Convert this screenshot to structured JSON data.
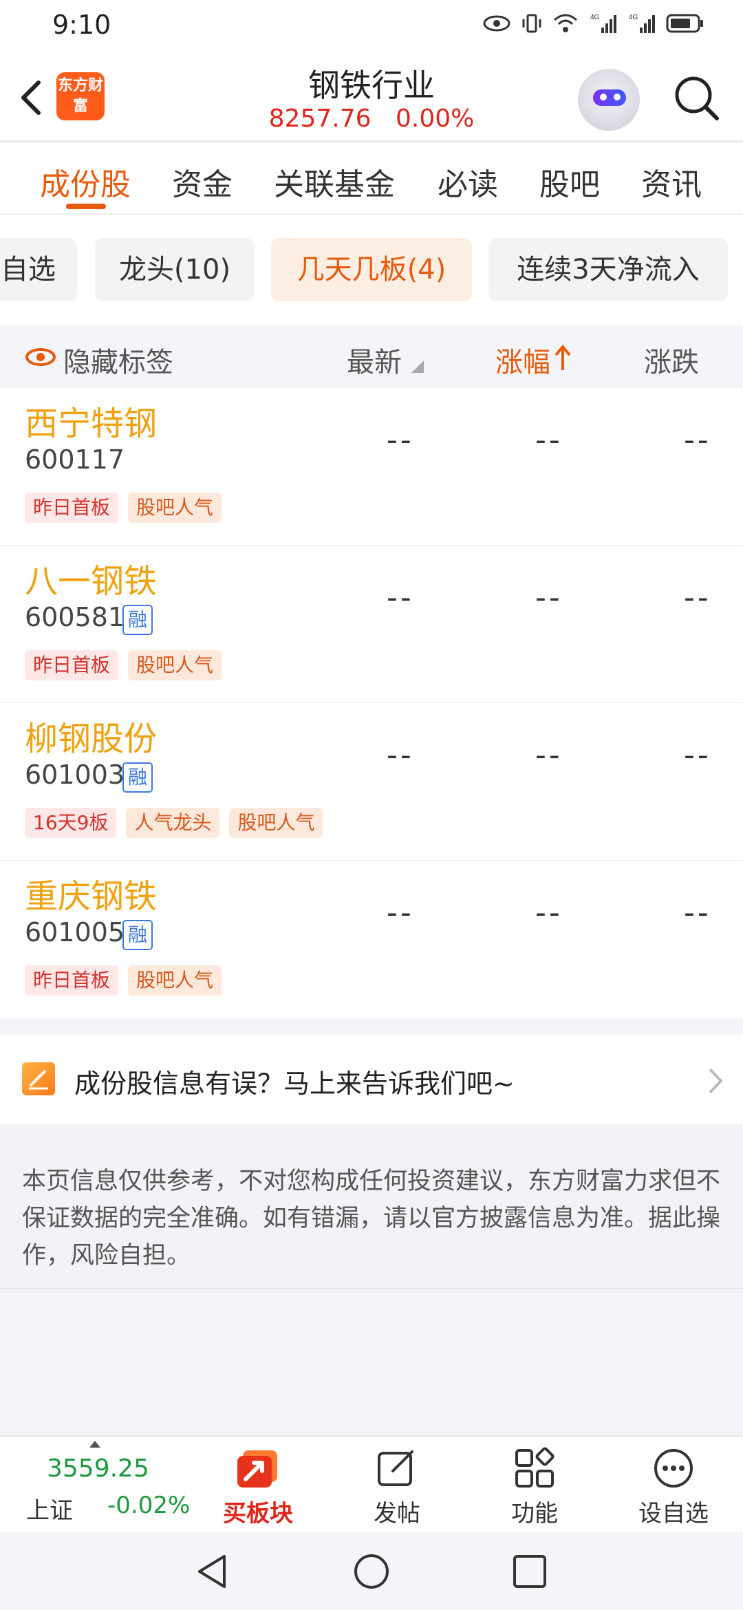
{
  "status_bar": {
    "time": "9:10",
    "icons": [
      "eye-icon",
      "vibrate-icon",
      "wifi-icon",
      "signal-4g-icon",
      "signal-4g-icon",
      "battery-icon"
    ]
  },
  "header": {
    "logo_text": "东方财富",
    "title": "钢铁行业",
    "index_value": "8257.76",
    "index_change": "0.00%"
  },
  "tabs": [
    {
      "label": "成份股",
      "active": true
    },
    {
      "label": "资金"
    },
    {
      "label": "关联基金"
    },
    {
      "label": "必读"
    },
    {
      "label": "股吧"
    },
    {
      "label": "资讯"
    }
  ],
  "chips": [
    {
      "label": "自选"
    },
    {
      "label": "龙头(10)"
    },
    {
      "label": "几天几板(4)",
      "active": true
    },
    {
      "label": "连续3天净流入"
    }
  ],
  "table_header": {
    "hide_tags": "隐藏标签",
    "latest": "最新",
    "change_pct": "涨幅",
    "change": "涨跌"
  },
  "rows": [
    {
      "name": "西宁特钢",
      "code": "600117",
      "margin": "",
      "tags": [
        "昨日首板",
        "股吧人气"
      ],
      "latest": "--",
      "change_pct": "--",
      "change": "--"
    },
    {
      "name": "八一钢铁",
      "code": "600581",
      "margin": "融",
      "tags": [
        "昨日首板",
        "股吧人气"
      ],
      "latest": "--",
      "change_pct": "--",
      "change": "--"
    },
    {
      "name": "柳钢股份",
      "code": "601003",
      "margin": "融",
      "tags": [
        "16天9板",
        "人气龙头",
        "股吧人气"
      ],
      "latest": "--",
      "change_pct": "--",
      "change": "--"
    },
    {
      "name": "重庆钢铁",
      "code": "601005",
      "margin": "融",
      "tags": [
        "昨日首板",
        "股吧人气"
      ],
      "latest": "--",
      "change_pct": "--",
      "change": "--"
    }
  ],
  "feedback": {
    "text": "成份股信息有误？马上来告诉我们吧~"
  },
  "disclaimer": "本页信息仅供参考，不对您构成任何投资建议，东方财富力求但不保证数据的完全准确。如有错漏，请以官方披露信息为准。据此操作，风险自担。",
  "bottom_bar": {
    "index_value": "3559.25",
    "index_name": "上证",
    "index_change": "-0.02%",
    "nav": [
      {
        "label": "买板块",
        "icon": "buy-sector-icon"
      },
      {
        "label": "发帖",
        "icon": "edit-icon"
      },
      {
        "label": "功能",
        "icon": "grid-icon"
      },
      {
        "label": "设自选",
        "icon": "more-icon"
      }
    ]
  },
  "colors": {
    "accent": "#e85a0c",
    "price_up": "#e0251b",
    "price_down": "#1a9a3a",
    "stock_name": "#f0a10e"
  }
}
